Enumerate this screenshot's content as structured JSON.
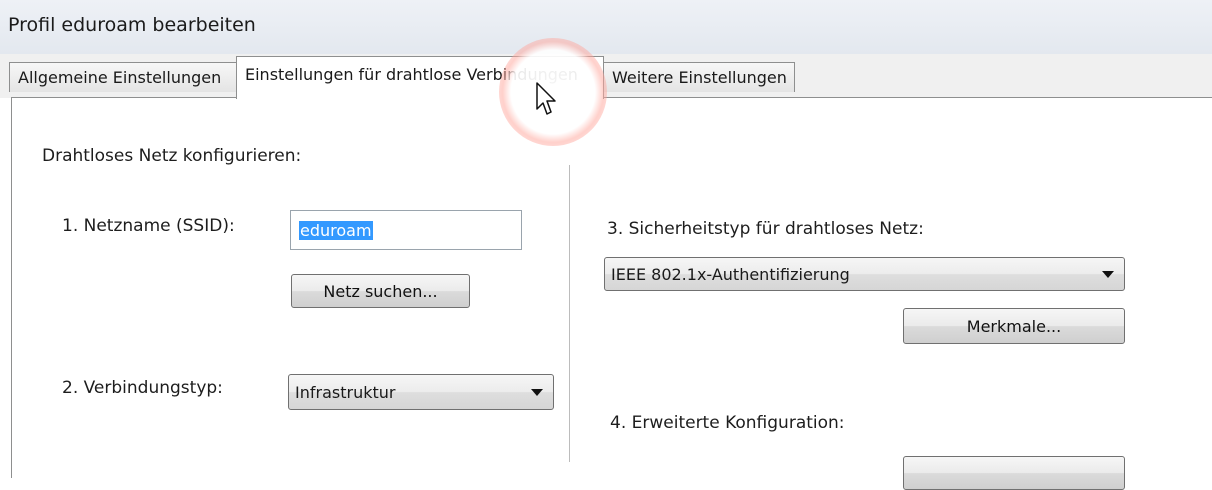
{
  "window": {
    "title": "Profil eduroam bearbeiten"
  },
  "tabs": [
    {
      "label": "Allgemeine Einstellungen",
      "active": false
    },
    {
      "label": "Einstellungen für drahtlose Verbindungen",
      "active": true
    },
    {
      "label": "Weitere Einstellungen",
      "active": false
    }
  ],
  "left": {
    "heading": "Drahtloses Netz konfigurieren:",
    "ssid_label": "1. Netzname (SSID):",
    "ssid_value": "eduroam",
    "search_button": "Netz suchen...",
    "conn_type_label": "2. Verbindungstyp:",
    "conn_type_value": "Infrastruktur"
  },
  "right": {
    "security_label": "3. Sicherheitstyp für drahtloses Netz:",
    "security_value": "IEEE 802.1x-Authentifizierung",
    "properties_button": "Merkmale...",
    "advanced_label": "4. Erweiterte Konfiguration:"
  },
  "colors": {
    "selection": "#3399ff",
    "highlight": "#ff8a7a"
  },
  "cursor": {
    "icon": "arrow-pointer-icon"
  }
}
